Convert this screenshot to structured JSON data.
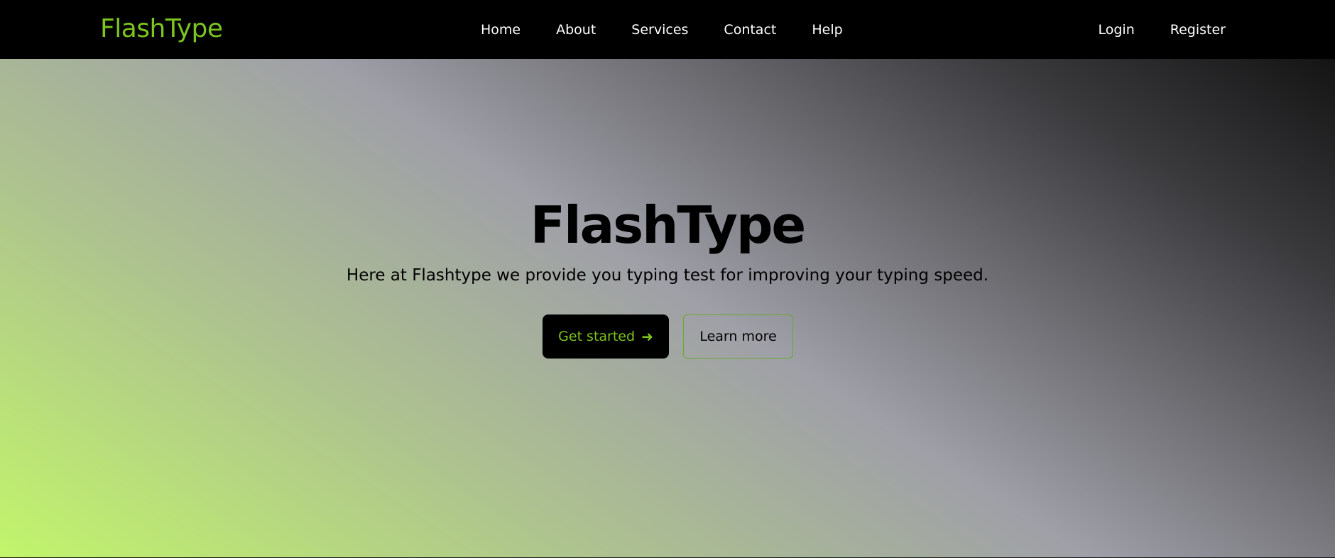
{
  "nav": {
    "brand": "FlashType",
    "links": [
      "Home",
      "About",
      "Services",
      "Contact",
      "Help"
    ],
    "auth": {
      "login": "Login",
      "register": "Register"
    }
  },
  "hero": {
    "title": "FlashType",
    "subtitle": "Here at Flashtype we provide you typing test for improving your typing speed.",
    "primary_button": "Get started",
    "primary_button_icon": "arrow-right-icon",
    "secondary_button": "Learn more"
  },
  "colors": {
    "brand_green": "#7cc41e",
    "nav_background": "#000000",
    "gradient_start": "#c2f56b",
    "gradient_mid": "#9f9fa8",
    "gradient_end": "#141414"
  }
}
